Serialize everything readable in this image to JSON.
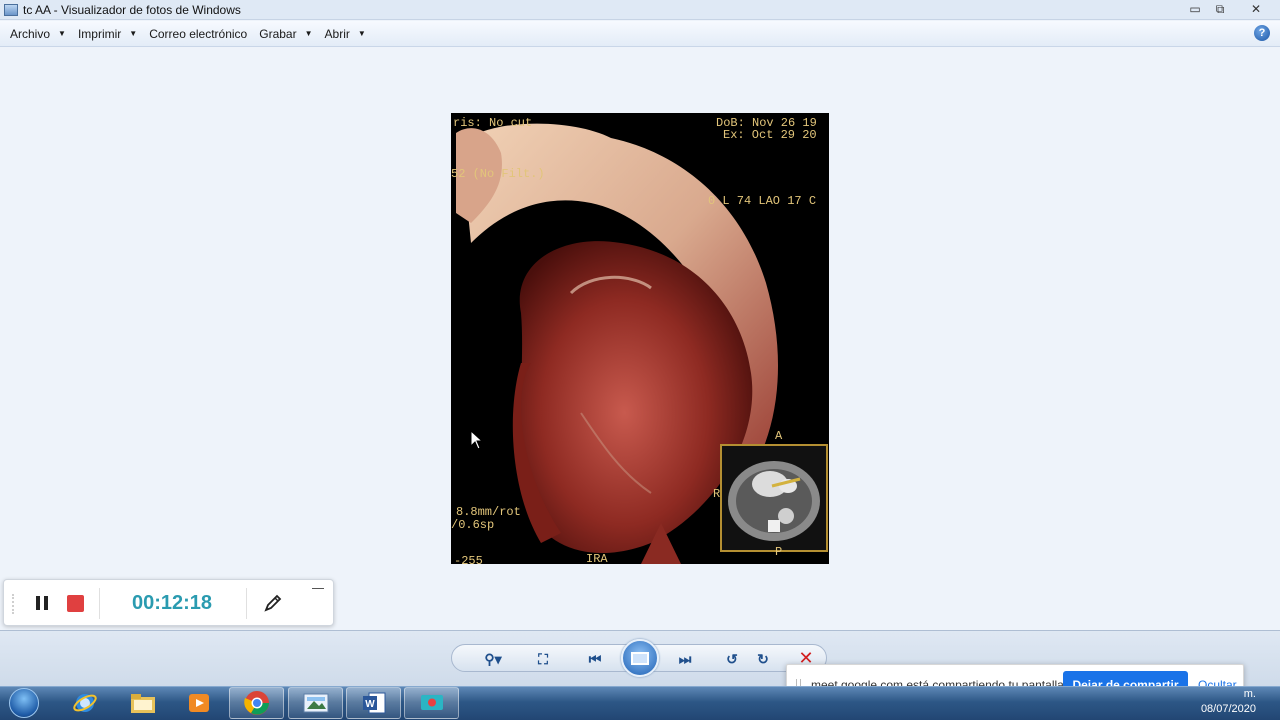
{
  "window": {
    "title": "tc AA - Visualizador de fotos de Windows"
  },
  "menu": [
    {
      "label": "Archivo",
      "has_dropdown": true
    },
    {
      "label": "Imprimir",
      "has_dropdown": true
    },
    {
      "label": "Correo electrónico",
      "has_dropdown": false
    },
    {
      "label": "Grabar",
      "has_dropdown": true
    },
    {
      "label": "Abrir",
      "has_dropdown": true
    }
  ],
  "help_label": "?",
  "photo_overlays": {
    "dob": "DoB: Nov 26 19",
    "exam": "Ex: Oct 29 20",
    "cut": "ris: No cut",
    "filter": "52 (No Filt.)",
    "angle": "0 L 74 LAO 17 C",
    "rotation": "8.8mm/rot",
    "speed": "/0.6sp",
    "window": "-255",
    "ira": "IRA",
    "inset_a": "A",
    "inset_r": "R",
    "inset_p": "P"
  },
  "recorder": {
    "timer": "00:12:18"
  },
  "share_banner": {
    "message": "meet.google.com está compartiendo tu pantalla.",
    "stop_label": "Dejar de compartir",
    "hide_label": "Ocultar"
  },
  "clock": {
    "time": "m.",
    "date": "08/07/2020"
  },
  "taskbar_apps": [
    "internet-explorer",
    "file-explorer",
    "media-player",
    "chrome",
    "photo-viewer",
    "word",
    "screen-recorder"
  ]
}
